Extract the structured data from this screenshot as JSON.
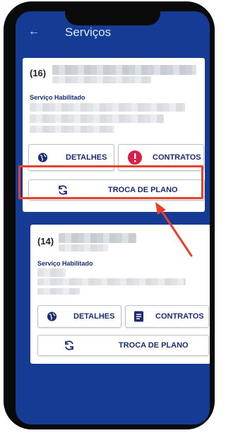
{
  "header": {
    "title": "Serviços"
  },
  "card1": {
    "number": "(16)",
    "service_label": "Serviço Habilitado",
    "details_label": "DETALHES",
    "contracts_label": "CONTRATOS",
    "swap_label": "TROCA DE PLANO"
  },
  "card2": {
    "number": "(14)",
    "service_label": "Serviço Habilitado",
    "details_label": "DETALHES",
    "contracts_label": "CONTRATOS",
    "swap_label": "TROCA DE PLANO"
  },
  "colors": {
    "brand_blue": "#153b94",
    "highlight_red": "#e8402a",
    "alert_red": "#d6204a"
  },
  "icons": [
    "back-arrow-icon",
    "globe-icon",
    "alert-icon",
    "refresh-icon",
    "document-icon",
    "annotation-arrow"
  ]
}
